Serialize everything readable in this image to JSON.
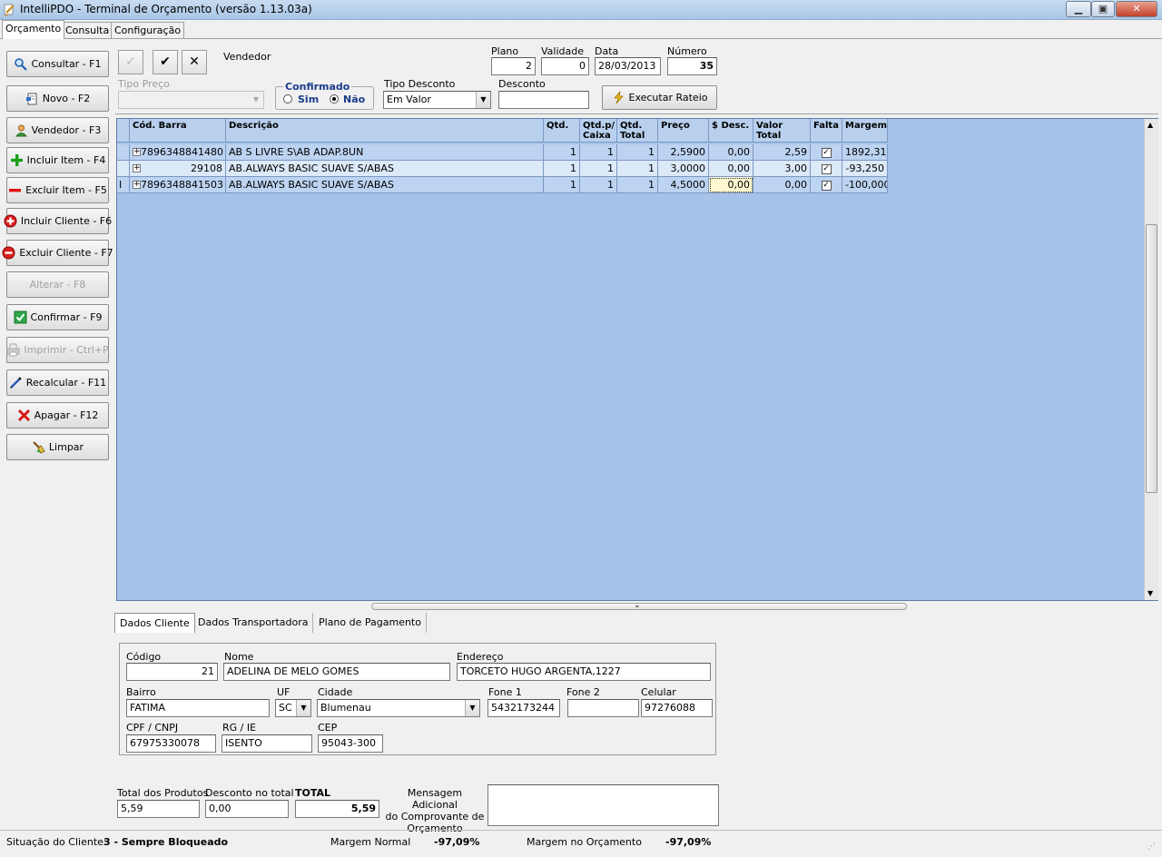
{
  "window": {
    "title": "IntelliPDO - Terminal de Orçamento  (versão 1.13.03a)",
    "minimize": "▁",
    "maximize": "▣",
    "close": "✕"
  },
  "tabs": [
    "Orçamento",
    "Consulta",
    "Configuração"
  ],
  "sidebar": {
    "buttons": [
      {
        "label": "Consultar - F1",
        "icon": "magnifier-icon",
        "enabled": true
      },
      {
        "label": "Novo - F2",
        "icon": "new-document-icon",
        "enabled": true
      },
      {
        "label": "Vendedor - F3",
        "icon": "person-icon",
        "enabled": true
      },
      {
        "label": "Incluir Item - F4",
        "icon": "plus-icon",
        "enabled": true
      },
      {
        "label": "Excluir Item - F5",
        "icon": "minus-icon",
        "enabled": true
      },
      {
        "label": "Incluir Cliente - F6",
        "icon": "add-client-icon",
        "enabled": true
      },
      {
        "label": "Excluir Cliente - F7",
        "icon": "remove-client-icon",
        "enabled": true
      },
      {
        "label": "Alterar - F8",
        "icon": "",
        "enabled": false
      },
      {
        "label": "Confirmar - F9",
        "icon": "checkmark-icon",
        "enabled": true
      },
      {
        "label": "Imprimir - Ctrl+P",
        "icon": "printer-icon",
        "enabled": false
      },
      {
        "label": "Recalcular - F11",
        "icon": "pen-icon",
        "enabled": true
      },
      {
        "label": "Apagar - F12",
        "icon": "red-x-icon",
        "enabled": true
      },
      {
        "label": "Limpar",
        "icon": "broom-icon",
        "enabled": true
      }
    ]
  },
  "toolbar": {
    "edit_symbol": "✓",
    "confirm_symbol": "✔",
    "cancel_symbol": "✕",
    "vendedor_label": "Vendedor"
  },
  "header": {
    "plano_label": "Plano",
    "plano": "2",
    "validade_label": "Validade",
    "validade": "0",
    "data_label": "Data",
    "data": "28/03/2013",
    "numero_label": "Número",
    "numero": "35",
    "tipo_preco_label": "Tipo Preço",
    "tipo_preco": "",
    "confirmado_label": "Confirmado",
    "sim_label": "Sim",
    "nao_label": "Não",
    "confirmado_selected": "Não",
    "tipo_desconto_label": "Tipo Desconto",
    "tipo_desconto": "Em Valor",
    "desconto_label": "Desconto",
    "desconto": "",
    "rateio_button": "Executar Rateio"
  },
  "grid": {
    "columns": [
      "Cód. Barra",
      "Descrição",
      "Qtd.",
      "Qtd.p/ Caixa",
      "Qtd. Total",
      "Preço",
      "$ Desc.",
      "Valor Total",
      "Falta",
      "Margem"
    ],
    "rows": [
      {
        "marker": "",
        "cod": "7896348841480",
        "desc": "AB S  LIVRE S\\AB ADAP.8UN",
        "qtd": "1",
        "qtd_caixa": "1",
        "qtd_total": "1",
        "preco": "2,5900",
        "desc_valor": "0,00",
        "valor_total": "2,59",
        "falta": true,
        "margem": "1892,310"
      },
      {
        "marker": "",
        "cod": "29108",
        "desc": "AB.ALWAYS BASIC SUAVE S/ABAS",
        "qtd": "1",
        "qtd_caixa": "1",
        "qtd_total": "1",
        "preco": "3,0000",
        "desc_valor": "0,00",
        "valor_total": "3,00",
        "falta": true,
        "margem": "-93,250"
      },
      {
        "marker": "I",
        "cod": "7896348841503",
        "desc": "AB.ALWAYS BASIC SUAVE S/ABAS",
        "qtd": "1",
        "qtd_caixa": "1",
        "qtd_total": "1",
        "preco": "4,5000",
        "desc_valor": "0,00",
        "valor_total": "0,00",
        "falta": true,
        "margem": "-100,000"
      }
    ]
  },
  "subtabs": [
    "Dados Cliente",
    "Dados Transportadora",
    "Plano de Pagamento"
  ],
  "client": {
    "codigo_label": "Código",
    "codigo": "21",
    "nome_label": "Nome",
    "nome": "ADELINA DE MELO GOMES",
    "endereco_label": "Endereço",
    "endereco": "TORCETO HUGO ARGENTA,1227",
    "bairro_label": "Bairro",
    "bairro": "FATIMA",
    "uf_label": "UF",
    "uf": "SC",
    "cidade_label": "Cidade",
    "cidade": "Blumenau",
    "fone1_label": "Fone 1",
    "fone1": "5432173244",
    "fone2_label": "Fone 2",
    "fone2": "",
    "celular_label": "Celular",
    "celular": "97276088",
    "cpf_label": "CPF / CNPJ",
    "cpf": "67975330078",
    "rg_label": "RG / IE",
    "rg": "ISENTO",
    "cep_label": "CEP",
    "cep": "95043-300"
  },
  "totals": {
    "produtos_label": "Total dos Produtos",
    "produtos": "5,59",
    "desconto_label": "Desconto no total",
    "desconto": "0,00",
    "total_label": "TOTAL",
    "total": "5,59",
    "mensagem_label_1": "Mensagem Adicional",
    "mensagem_label_2": "do Comprovante de",
    "mensagem_label_3": "Orçamento",
    "mensagem": ""
  },
  "status": {
    "situacao_label": "Situação do Cliente:",
    "situacao": "3 - Sempre Bloqueado",
    "margem_normal_label": "Margem Normal",
    "margem_normal": "-97,09%",
    "margem_orcamento_label": "Margem no Orçamento",
    "margem_orcamento": "-97,09%"
  }
}
